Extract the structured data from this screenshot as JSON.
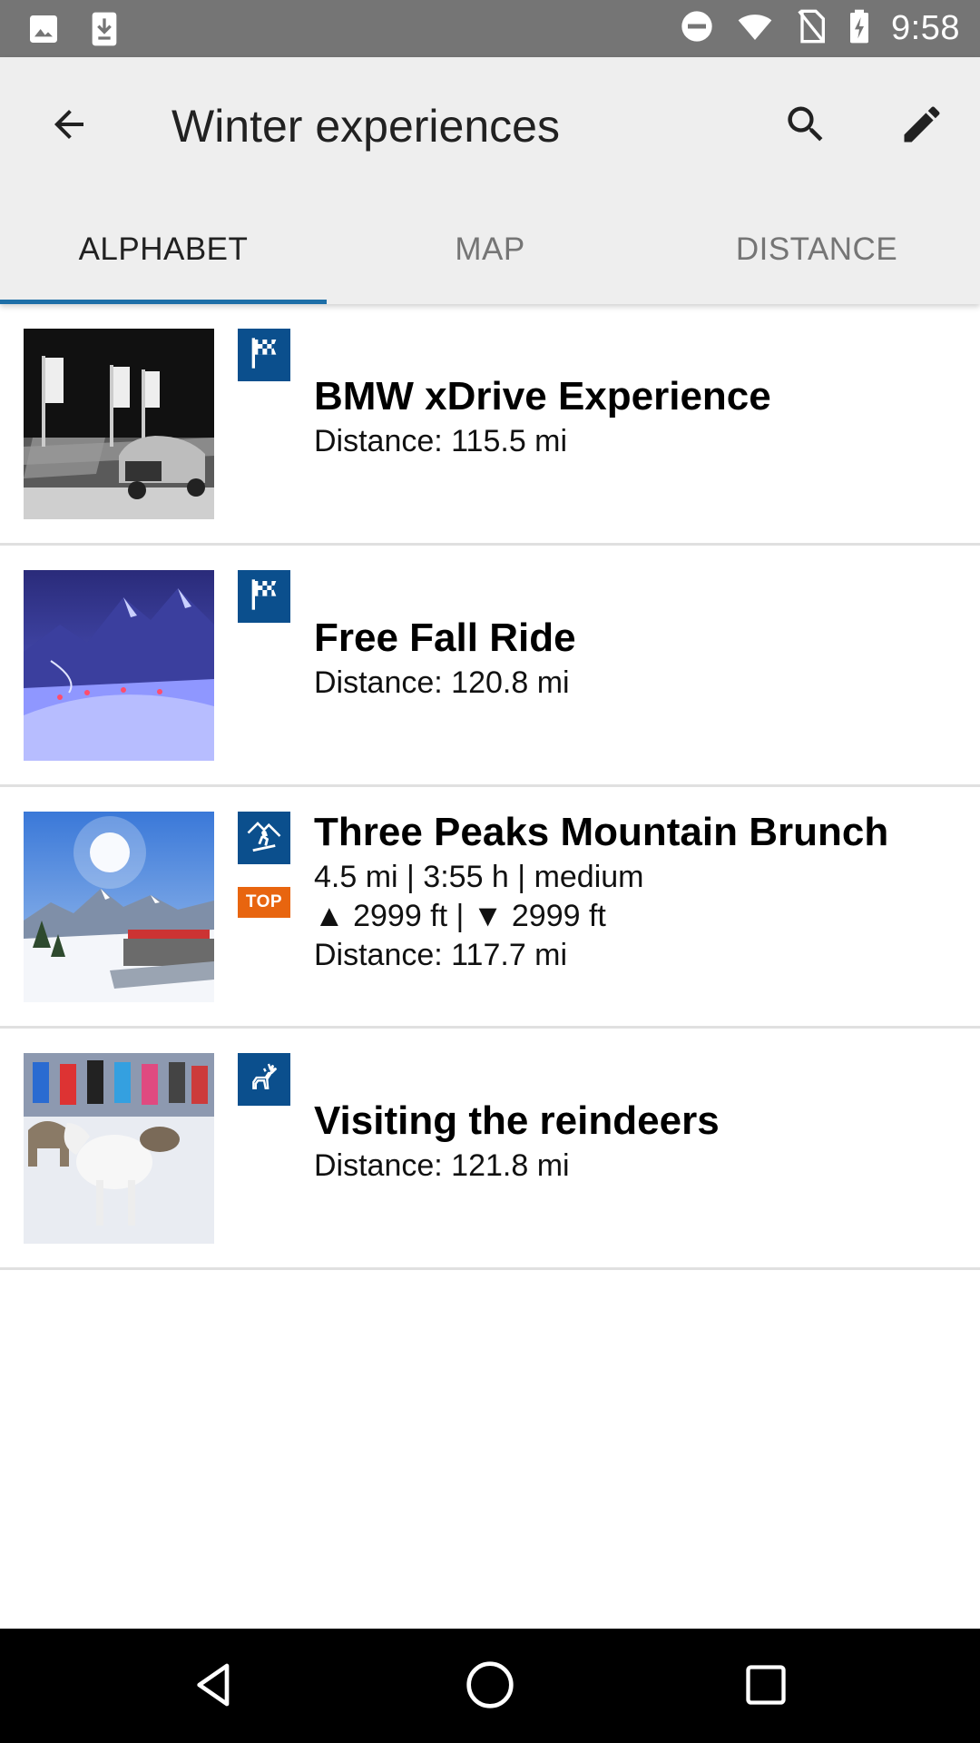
{
  "status_bar": {
    "time": "9:58",
    "left_icons": [
      "image-icon",
      "download-icon"
    ],
    "right_icons": [
      "do-not-disturb-icon",
      "wifi-icon",
      "no-sim-icon",
      "battery-charging-icon"
    ]
  },
  "app_bar": {
    "title": "Winter experiences",
    "actions": [
      "back-arrow-icon",
      "search-icon",
      "edit-pencil-icon"
    ]
  },
  "tabs": [
    {
      "label": "ALPHABET",
      "active": true
    },
    {
      "label": "MAP",
      "active": false
    },
    {
      "label": "DISTANCE",
      "active": false
    }
  ],
  "items": [
    {
      "title": "BMW xDrive Experience",
      "lines": [
        "Distance: 115.5 mi"
      ],
      "category_icon": "checkered-flag-icon",
      "thumbnail": "car-on-snow-night"
    },
    {
      "title": "Free Fall Ride",
      "lines": [
        "Distance: 120.8 mi"
      ],
      "category_icon": "checkered-flag-icon",
      "thumbnail": "mountain-snowcat-night"
    },
    {
      "title": "Three Peaks Mountain Brunch",
      "lines": [
        "4.5 mi | 3:55 h | medium",
        "▲ 2999 ft | ▼ 2999 ft",
        "Distance: 117.7 mi"
      ],
      "category_icon": "snowshoe-hiker-icon",
      "badge": "TOP",
      "thumbnail": "sunny-mountain-terrace"
    },
    {
      "title": "Visiting the reindeers",
      "lines": [
        "Distance: 121.8 mi"
      ],
      "category_icon": "reindeer-icon",
      "thumbnail": "reindeer-in-snow"
    }
  ],
  "colors": {
    "status_bar": "#757575",
    "app_bar": "#eeeeee",
    "tab_indicator": "#1e6fa8",
    "category_icon_bg": "#0b4f8d",
    "top_badge": "#e8650f"
  }
}
